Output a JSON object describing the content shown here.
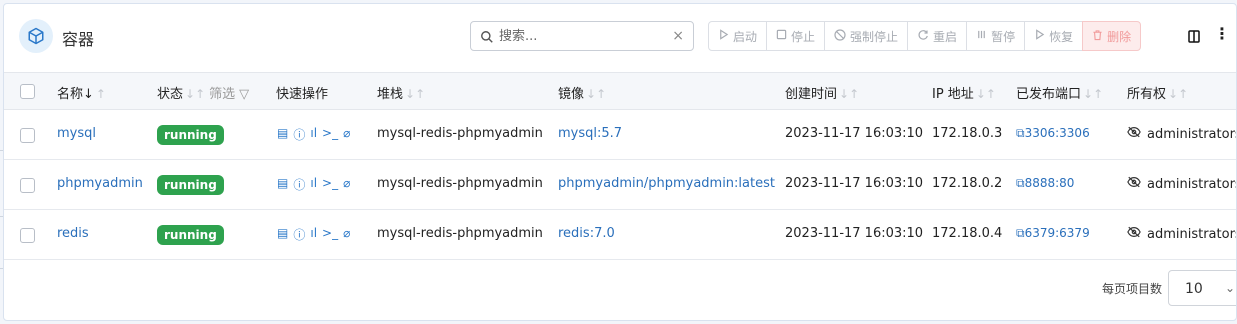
{
  "header": {
    "title": "容器",
    "icon": "box-icon",
    "search_placeholder": "搜索...",
    "clear_symbol": "×"
  },
  "toolbar": {
    "start": "启动",
    "stop": "停止",
    "kill": "强制停止",
    "restart": "重启",
    "pause": "暂停",
    "resume": "恢复",
    "remove": "删除"
  },
  "table": {
    "columns": {
      "name": "名称",
      "name_sort": "↓",
      "state": "状态",
      "filter": "筛选",
      "actions": "快速操作",
      "stack": "堆栈",
      "image": "镜像",
      "created": "创建时间",
      "ip": "IP 地址",
      "ports": "已发布端口",
      "ownership": "所有权"
    },
    "rows": [
      {
        "name": "mysql",
        "state": "running",
        "stack": "mysql-redis-phpmyadmin",
        "image": "mysql:5.7",
        "created": "2023-11-17 16:03:10",
        "ip": "172.18.0.3",
        "port": "3306:3306",
        "ownership": "administrators"
      },
      {
        "name": "phpmyadmin",
        "state": "running",
        "stack": "mysql-redis-phpmyadmin",
        "image": "phpmyadmin/phpmyadmin:latest",
        "created": "2023-11-17 16:03:10",
        "ip": "172.18.0.2",
        "port": "8888:80",
        "ownership": "administrators"
      },
      {
        "name": "redis",
        "state": "running",
        "stack": "mysql-redis-phpmyadmin",
        "image": "redis:7.0",
        "created": "2023-11-17 16:03:10",
        "ip": "172.18.0.4",
        "port": "6379:6379",
        "ownership": "administrators"
      }
    ]
  },
  "footer": {
    "per_page_label": "每页项目数",
    "per_page_value": "10"
  },
  "colors": {
    "accent": "#2a6fbb",
    "running": "#2ea24e",
    "danger": "#f19a9a"
  }
}
